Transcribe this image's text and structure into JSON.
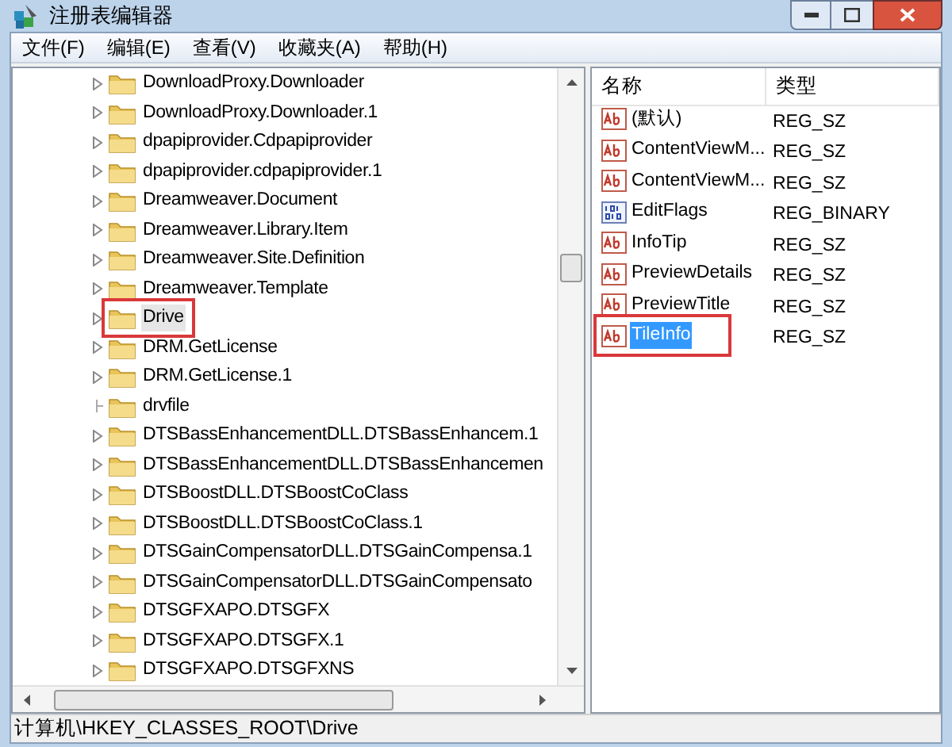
{
  "window": {
    "title": "注册表编辑器"
  },
  "menu": [
    "文件(F)",
    "编辑(E)",
    "查看(V)",
    "收藏夹(A)",
    "帮助(H)"
  ],
  "tree": {
    "items": [
      {
        "label": "DownloadProxy.Downloader",
        "expandable": true,
        "selected": false,
        "highlighted": false
      },
      {
        "label": "DownloadProxy.Downloader.1",
        "expandable": true,
        "selected": false,
        "highlighted": false
      },
      {
        "label": "dpapiprovider.Cdpapiprovider",
        "expandable": true,
        "selected": false,
        "highlighted": false
      },
      {
        "label": "dpapiprovider.cdpapiprovider.1",
        "expandable": true,
        "selected": false,
        "highlighted": false
      },
      {
        "label": "Dreamweaver.Document",
        "expandable": true,
        "selected": false,
        "highlighted": false
      },
      {
        "label": "Dreamweaver.Library.Item",
        "expandable": true,
        "selected": false,
        "highlighted": false
      },
      {
        "label": "Dreamweaver.Site.Definition",
        "expandable": true,
        "selected": false,
        "highlighted": false
      },
      {
        "label": "Dreamweaver.Template",
        "expandable": true,
        "selected": false,
        "highlighted": false
      },
      {
        "label": "Drive",
        "expandable": true,
        "selected": true,
        "highlighted": true
      },
      {
        "label": "DRM.GetLicense",
        "expandable": true,
        "selected": false,
        "highlighted": false
      },
      {
        "label": "DRM.GetLicense.1",
        "expandable": true,
        "selected": false,
        "highlighted": false
      },
      {
        "label": "drvfile",
        "expandable": false,
        "selected": false,
        "highlighted": false
      },
      {
        "label": "DTSBassEnhancementDLL.DTSBassEnhancem.1",
        "expandable": true,
        "selected": false,
        "highlighted": false
      },
      {
        "label": "DTSBassEnhancementDLL.DTSBassEnhancemen",
        "expandable": true,
        "selected": false,
        "highlighted": false
      },
      {
        "label": "DTSBoostDLL.DTSBoostCoClass",
        "expandable": true,
        "selected": false,
        "highlighted": false
      },
      {
        "label": "DTSBoostDLL.DTSBoostCoClass.1",
        "expandable": true,
        "selected": false,
        "highlighted": false
      },
      {
        "label": "DTSGainCompensatorDLL.DTSGainCompensa.1",
        "expandable": true,
        "selected": false,
        "highlighted": false
      },
      {
        "label": "DTSGainCompensatorDLL.DTSGainCompensato",
        "expandable": true,
        "selected": false,
        "highlighted": false
      },
      {
        "label": "DTSGFXAPO.DTSGFX",
        "expandable": true,
        "selected": false,
        "highlighted": false
      },
      {
        "label": "DTSGFXAPO.DTSGFX.1",
        "expandable": true,
        "selected": false,
        "highlighted": false
      },
      {
        "label": "DTSGFXAPO.DTSGFXNS",
        "expandable": true,
        "selected": false,
        "highlighted": false
      }
    ]
  },
  "values": {
    "columns": [
      "名称",
      "类型"
    ],
    "rows": [
      {
        "kind": "string",
        "name": "(默认)",
        "type": "REG_SZ",
        "selected": false,
        "highlighted": false
      },
      {
        "kind": "string",
        "name": "ContentViewM...",
        "type": "REG_SZ",
        "selected": false,
        "highlighted": false
      },
      {
        "kind": "string",
        "name": "ContentViewM...",
        "type": "REG_SZ",
        "selected": false,
        "highlighted": false
      },
      {
        "kind": "binary",
        "name": "EditFlags",
        "type": "REG_BINARY",
        "selected": false,
        "highlighted": false
      },
      {
        "kind": "string",
        "name": "InfoTip",
        "type": "REG_SZ",
        "selected": false,
        "highlighted": false
      },
      {
        "kind": "string",
        "name": "PreviewDetails",
        "type": "REG_SZ",
        "selected": false,
        "highlighted": false
      },
      {
        "kind": "string",
        "name": "PreviewTitle",
        "type": "REG_SZ",
        "selected": false,
        "highlighted": false
      },
      {
        "kind": "string",
        "name": "TileInfo",
        "type": "REG_SZ",
        "selected": true,
        "highlighted": true
      }
    ]
  },
  "status_bar": "计算机\\HKEY_CLASSES_ROOT\\Drive"
}
